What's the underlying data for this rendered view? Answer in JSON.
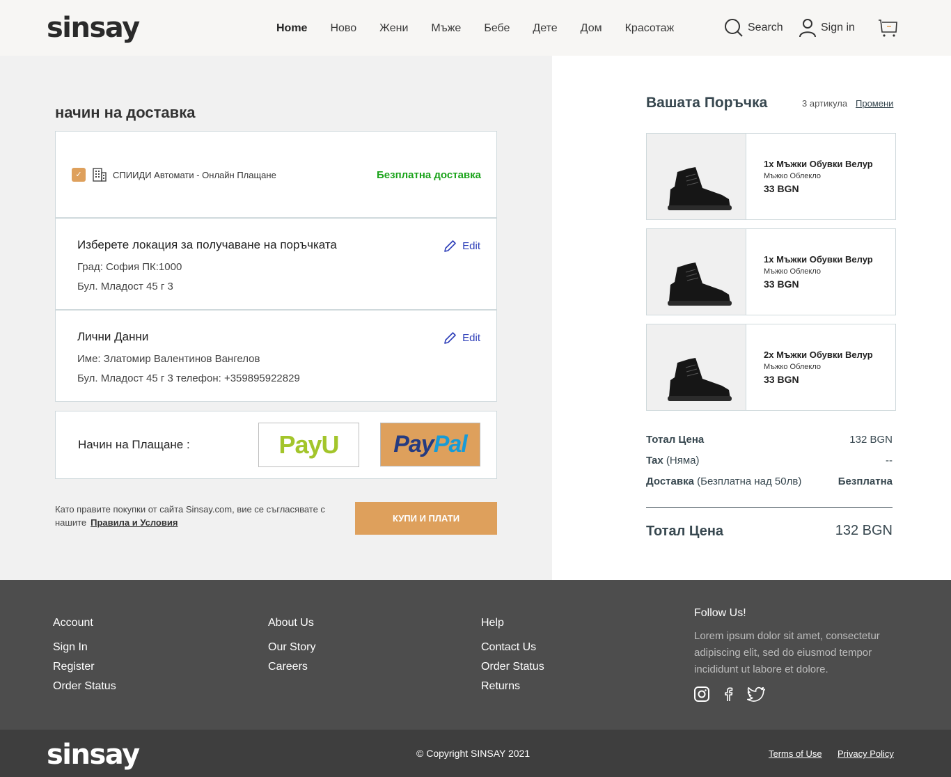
{
  "header": {
    "logo": "sinsay",
    "nav": [
      "Home",
      "Ново",
      "Жени",
      "Мъже",
      "Бебе",
      "Дете",
      "Дом",
      "Красотаж"
    ],
    "search_label": "Search",
    "signin_label": "Sign in"
  },
  "delivery": {
    "title": "начин на доставка",
    "option_name": "СПИИДИ Автомати",
    "option_sep": " - ",
    "option_desc": "Онлайн Плащане",
    "free_label": "Безплатна доставка"
  },
  "location": {
    "title": "Изберете локация за получаване на поръчката",
    "line1": "Град: София ПК:1000",
    "line2": "Бул. Младост 45 г 3",
    "edit_label": "Edit"
  },
  "personal": {
    "title": "Лични Данни",
    "line1": "Име: Златомир Валентинов Вангелов",
    "line2": "Бул. Младост 45 г 3 телефон: +359895922829",
    "edit_label": "Edit"
  },
  "payment": {
    "label": "Начин на Плащане :",
    "payu": "PayU",
    "paypal_a": "Pay",
    "paypal_b": "Pal"
  },
  "terms": {
    "text": "Като правите покупки от сайта Sinsay.com, вие се съгласявате с нашите",
    "link": "Правила и Условия"
  },
  "buy_button": "КУПИ И ПЛАТИ",
  "order": {
    "title": "Вашата Поръчка",
    "count": "3 артикула",
    "change": "Промени",
    "items": [
      {
        "name": "1х Мъжки Обувки Велур",
        "category": "Мъжко Облекло",
        "price": "33 BGN"
      },
      {
        "name": "1х Мъжки Обувки Велур",
        "category": "Мъжко Облекло",
        "price": "33 BGN"
      },
      {
        "name": "2х Мъжки Обувки Велур",
        "category": "Мъжко Облекло",
        "price": "33 BGN"
      }
    ],
    "subtotal_label": "Тотал Цена",
    "subtotal_value": "132 BGN",
    "tax_label": "Tax",
    "tax_note": "(Няма)",
    "tax_value": "--",
    "shipping_label": "Доставка",
    "shipping_note": "(Безплатна над 50лв)",
    "shipping_value": "Безплатна",
    "total_label": "Тотал Цена",
    "total_value": "132 BGN"
  },
  "footer": {
    "account": {
      "title": "Account",
      "links": [
        "Sign In",
        "Register",
        "Order Status"
      ]
    },
    "about": {
      "title": "About Us",
      "links": [
        "Our Story",
        "Careers"
      ]
    },
    "help": {
      "title": "Help",
      "links": [
        "Contact Us",
        "Order Status",
        "Returns"
      ]
    },
    "follow_title": "Follow Us!",
    "follow_text": "Lorem ipsum dolor sit amet, consectetur adipiscing elit, sed do eiusmod tempor incididunt ut labore et dolore.",
    "copyright": "© Copyright SINSAY 2021",
    "terms_of_use": "Terms of Use",
    "privacy": "Privacy Policy",
    "logo": "sinsay"
  }
}
